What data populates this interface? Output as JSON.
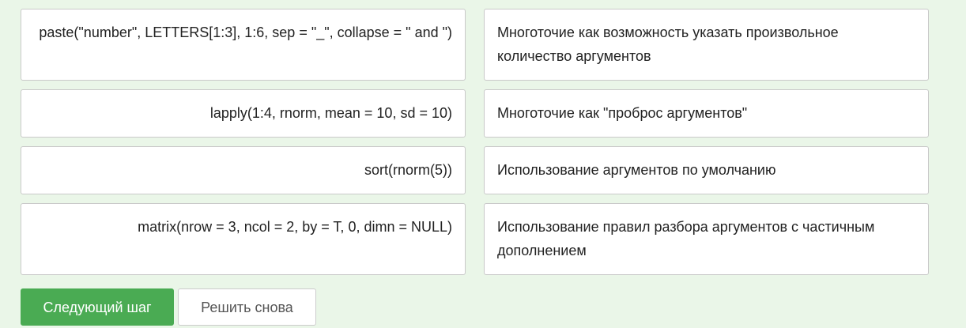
{
  "matching": {
    "left_items": [
      "paste(\"number\", LETTERS[1:3], 1:6, sep = \"_\", collapse = \" and \")",
      "lapply(1:4, rnorm, mean = 10, sd = 10)",
      "sort(rnorm(5))",
      "matrix(nrow = 3, ncol = 2, by = T, 0, dimn = NULL)"
    ],
    "right_items": [
      "Многоточие как возможность указать произвольное количество аргументов",
      "Многоточие как \"проброс аргументов\"",
      "Использование аргументов по умолчанию",
      "Использование правил разбора аргументов с частичным дополнением"
    ]
  },
  "actions": {
    "next_step_label": "Следующий шаг",
    "solve_again_label": "Решить снова"
  }
}
